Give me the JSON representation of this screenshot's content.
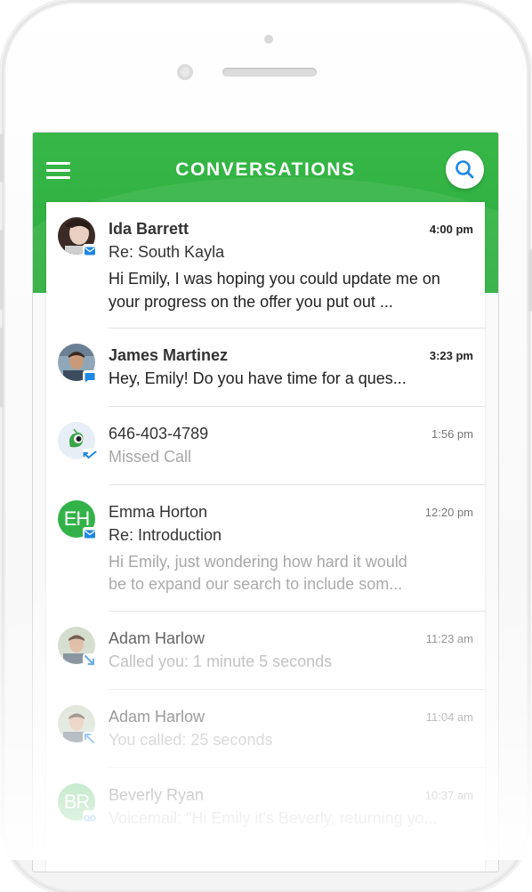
{
  "header": {
    "title": "CONVERSATIONS",
    "color": "#30B342"
  },
  "conversations": [
    {
      "name": "Ida Barrett",
      "time": "4:00 pm",
      "subject": "Re: South Kayla",
      "preview_line1": "Hi Emily, I was hoping you could update me on",
      "preview_line2": "your progress on the offer you put out ...",
      "type_icon": "email-icon",
      "unread": true
    },
    {
      "name": "James Martinez",
      "time": "3:23 pm",
      "subject": "Hey, Emily! Do you have time for a ques...",
      "type_icon": "chat-icon",
      "unread": true
    },
    {
      "name": "646-403-4789",
      "time": "1:56 pm",
      "subject": "Missed Call",
      "type_icon": "missed-call-icon",
      "unread": false
    },
    {
      "name": "Emma Horton",
      "initials": "EH",
      "time": "12:20 pm",
      "subject": "Re: Introduction",
      "preview_line1": "Hi Emily, just wondering how hard it would",
      "preview_line2": "be to expand our search to include som...",
      "type_icon": "email-icon",
      "unread": false
    },
    {
      "name": "Adam Harlow",
      "time": "11:23 am",
      "subject": "Called you: 1 minute 5 seconds",
      "type_icon": "incoming-call-icon",
      "unread": false
    },
    {
      "name": "Adam Harlow",
      "time": "11:04 am",
      "subject": "You called:  25 seconds",
      "type_icon": "outgoing-call-icon",
      "unread": false
    },
    {
      "name": "Beverly Ryan",
      "initials": "BR",
      "time": "10:37 am",
      "subject": "Voicemail: \"Hi Emily it's Beverly, returning yo...",
      "type_icon": "voicemail-icon",
      "unread": false
    }
  ],
  "colors": {
    "accent_blue": "#1E88E5",
    "green": "#30B342"
  }
}
